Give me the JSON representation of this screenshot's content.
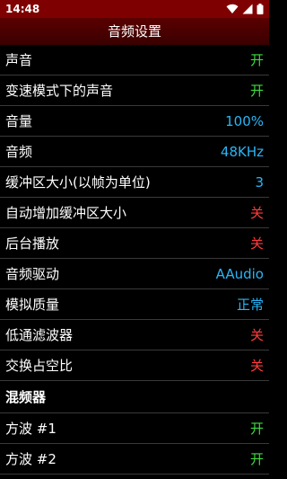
{
  "status_bar": {
    "time": "14:48",
    "icons": [
      "wifi-icon",
      "signal-icon",
      "battery-icon"
    ]
  },
  "header": {
    "title": "音频设置"
  },
  "settings": [
    {
      "label": "声音",
      "value": "开"
    },
    {
      "label": "变速模式下的声音",
      "value": "开"
    },
    {
      "label": "音量",
      "value": "100%"
    },
    {
      "label": "音频",
      "value": "48KHz"
    },
    {
      "label": "缓冲区大小(以帧为单位)",
      "value": "3"
    },
    {
      "label": "自动增加缓冲区大小",
      "value": "关"
    },
    {
      "label": "后台播放",
      "value": "关"
    },
    {
      "label": "音频驱动",
      "value": "AAudio"
    },
    {
      "label": "模拟质量",
      "value": "正常"
    },
    {
      "label": "低通滤波器",
      "value": "关"
    },
    {
      "label": "交换占空比",
      "value": "关"
    }
  ],
  "mixer_section": {
    "title": "混频器",
    "items": [
      {
        "label": "方波 #1",
        "value": "开"
      },
      {
        "label": "方波 #2",
        "value": "开"
      }
    ]
  },
  "colors": {
    "status_bar": "#7f0000",
    "title_bar": "#4a0000",
    "on": "#3ddc3d",
    "off": "#ff3b3b",
    "info": "#29b6f6"
  }
}
